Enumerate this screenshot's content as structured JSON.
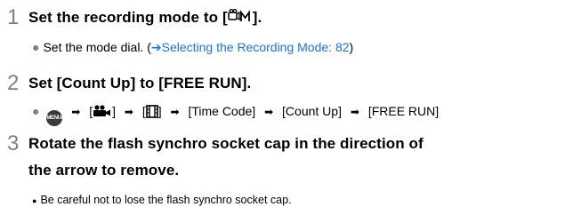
{
  "steps": [
    {
      "number": "1",
      "title_prefix": "Set the recording mode to [",
      "title_icon": "movie-mode-icon",
      "title_suffix": "].",
      "sub_text": "Set the mode dial. (",
      "sub_arrow": "➔",
      "sub_link": "Selecting the Recording Mode: 82",
      "sub_end": ")"
    },
    {
      "number": "2",
      "title": "Set [Count Up] to [FREE RUN].",
      "menu_button_label": "MENU/SET",
      "path": [
        "[Time Code]",
        "[Count Up]",
        "[FREE RUN]"
      ]
    },
    {
      "number": "3",
      "title_line1": "Rotate the flash synchro socket cap in the direction of",
      "title_line2": "the arrow to remove.",
      "sub_text": "Be careful not to lose the flash synchro socket cap."
    }
  ],
  "glyphs": {
    "bullet": "●",
    "arrow": "➡"
  }
}
